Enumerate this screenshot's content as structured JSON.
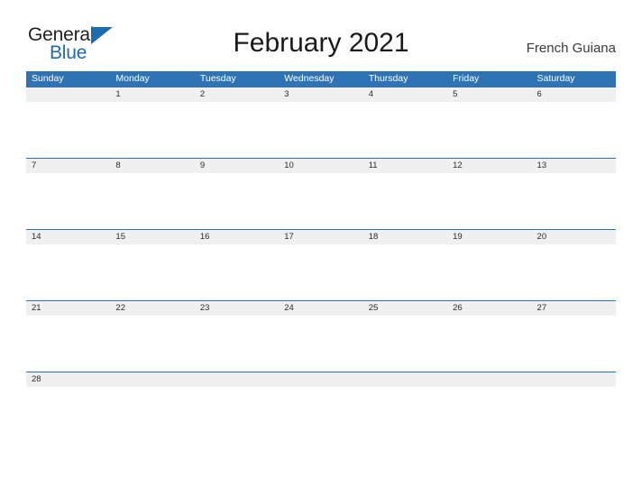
{
  "brand": {
    "word_one": "General",
    "word_two": "Blue",
    "flag_icon": "blue-triangle-flag",
    "accent_color": "#1b6cb0"
  },
  "header": {
    "title": "February 2021",
    "location": "French Guiana"
  },
  "colors": {
    "header_blue": "#2e74b5",
    "row_divider_blue": "#2e74b5",
    "daynum_band": "#f0f0f0",
    "text": "#231f20"
  },
  "calendar": {
    "month": "February",
    "year": "2021",
    "weekday_headers": [
      "Sunday",
      "Monday",
      "Tuesday",
      "Wednesday",
      "Thursday",
      "Friday",
      "Saturday"
    ],
    "weeks": [
      {
        "days": [
          {
            "num": ""
          },
          {
            "num": "1"
          },
          {
            "num": "2"
          },
          {
            "num": "3"
          },
          {
            "num": "4"
          },
          {
            "num": "5"
          },
          {
            "num": "6"
          }
        ]
      },
      {
        "days": [
          {
            "num": "7"
          },
          {
            "num": "8"
          },
          {
            "num": "9"
          },
          {
            "num": "10"
          },
          {
            "num": "11"
          },
          {
            "num": "12"
          },
          {
            "num": "13"
          }
        ]
      },
      {
        "days": [
          {
            "num": "14"
          },
          {
            "num": "15"
          },
          {
            "num": "16"
          },
          {
            "num": "17"
          },
          {
            "num": "18"
          },
          {
            "num": "19"
          },
          {
            "num": "20"
          }
        ]
      },
      {
        "days": [
          {
            "num": "21"
          },
          {
            "num": "22"
          },
          {
            "num": "23"
          },
          {
            "num": "24"
          },
          {
            "num": "25"
          },
          {
            "num": "26"
          },
          {
            "num": "27"
          }
        ]
      },
      {
        "days": [
          {
            "num": "28"
          },
          {
            "num": ""
          },
          {
            "num": ""
          },
          {
            "num": ""
          },
          {
            "num": ""
          },
          {
            "num": ""
          },
          {
            "num": ""
          }
        ]
      }
    ]
  }
}
